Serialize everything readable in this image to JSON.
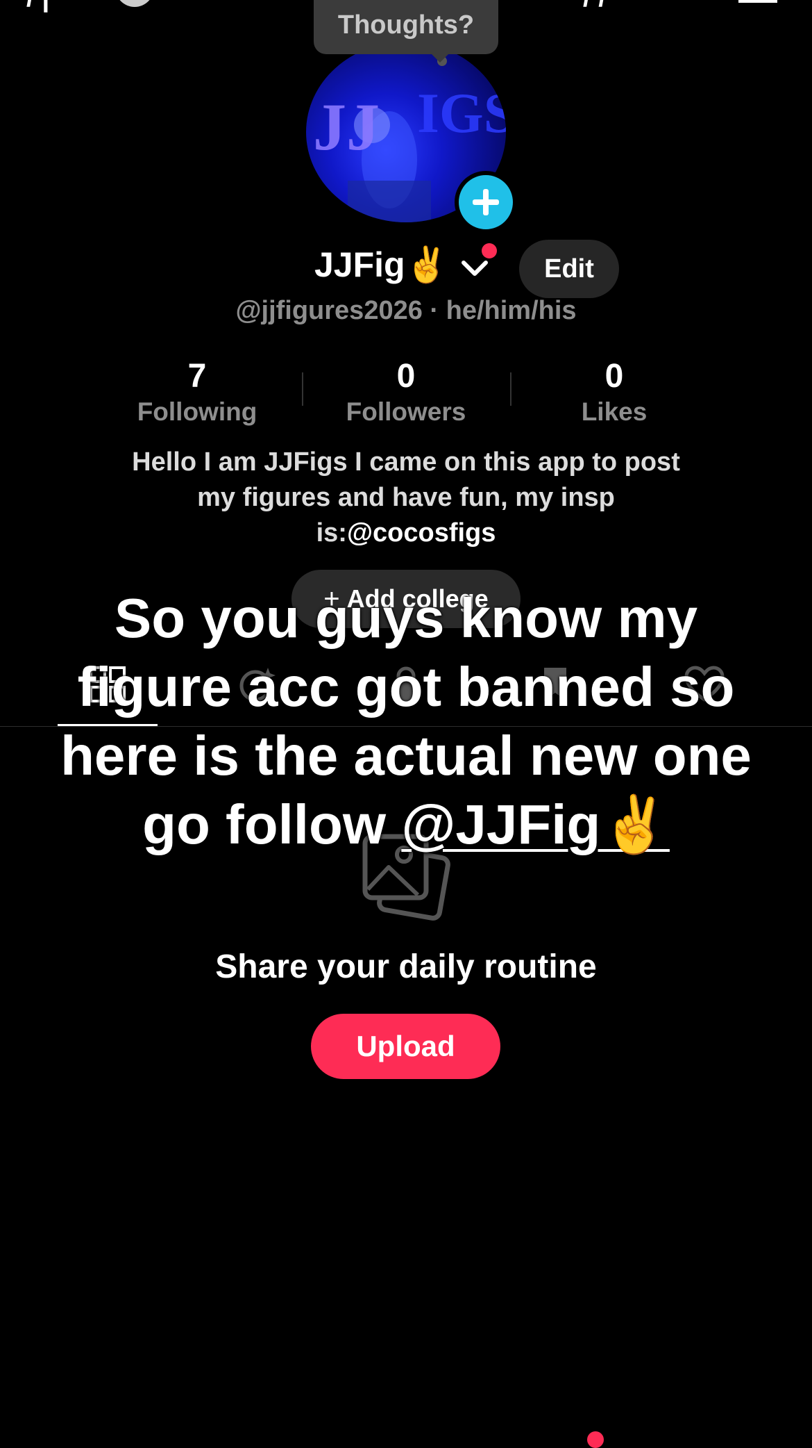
{
  "top_bar": {
    "left_glyphs": "/ |",
    "right_glyphs": "/ /"
  },
  "thoughts_bubble": {
    "label": "Thoughts?"
  },
  "avatar": {
    "logo_text": "JJFIGS"
  },
  "profile": {
    "name": "JJFig✌️",
    "edit_label": "Edit",
    "handle": "@jjfigures2026 · he/him/his"
  },
  "stats": [
    {
      "value": "7",
      "label": "Following"
    },
    {
      "value": "0",
      "label": "Followers"
    },
    {
      "value": "0",
      "label": "Likes"
    }
  ],
  "bio": {
    "line1": "Hello I am JJFigs I came on this app to post",
    "line2": "my figures and have fun, my insp",
    "line3_prefix": "is:",
    "line3_mention": "@cocosfigs"
  },
  "college": {
    "label": "Add college"
  },
  "tabs": [
    {
      "icon": "grid-icon"
    },
    {
      "icon": "sparkle-icon"
    },
    {
      "icon": "lock-icon"
    },
    {
      "icon": "bookmark-icon"
    },
    {
      "icon": "heart-icon"
    }
  ],
  "empty_state": {
    "icon": "photos-icon",
    "title": "Share your daily routine",
    "upload_label": "Upload"
  },
  "caption": {
    "line1": "So you guys know my",
    "line2": "figure acc got banned so",
    "line3": "here is the actual new one",
    "line4_prefix": "go follow ",
    "line4_mention": "@JJFig✌️"
  },
  "colors": {
    "accent": "#fe2c55",
    "add_badge": "#20c0e8",
    "muted_text": "#8e8e8e"
  }
}
